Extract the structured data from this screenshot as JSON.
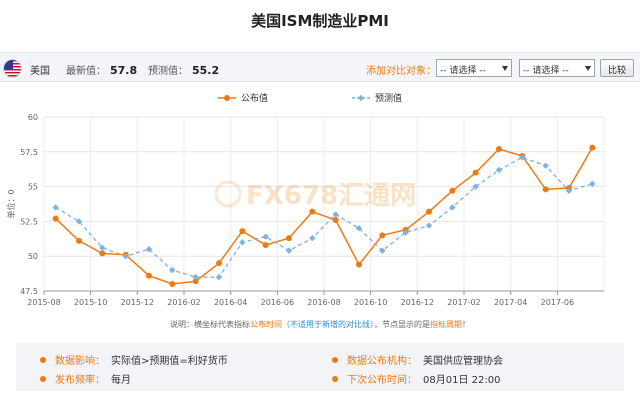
{
  "page": {
    "title": "美国ISM制造业PMI"
  },
  "toolbar": {
    "country": "美国",
    "latest_label": "最新值：",
    "latest_value": "57.8",
    "forecast_label": "预测值：",
    "forecast_value": "55.2",
    "compare_label": "添加对比对象：",
    "select1": "-- 请选择 --",
    "select2": "-- 请选择 --",
    "compare_button": "比较"
  },
  "note": {
    "prefix": "说明：横坐标代表指标",
    "highlight1": "公布时间",
    "paren": "（不适用于新增的对比线）",
    "middle": "，节点显示的是",
    "highlight2": "指标周期",
    "suffix": "！"
  },
  "info": {
    "impact_key": "数据影响：",
    "impact_val": "实际值>预期值=利好货币",
    "agency_key": "数据公布机构：",
    "agency_val": "美国供应管理协会",
    "freq_key": "发布频率：",
    "freq_val": "每月",
    "next_key": "下次公布时间：",
    "next_val": "08月01日 22:00"
  },
  "colors": {
    "actual": "#f07a12",
    "forecast": "#7fb2e0",
    "accent": "#f07a12",
    "watermark": "#f3a24a"
  },
  "chart_data": {
    "type": "line",
    "ylabel": "单位：0",
    "ylim": [
      47.5,
      60
    ],
    "yticks": [
      "47.5",
      "50",
      "52.5",
      "55",
      "57.5",
      "60"
    ],
    "xticks": [
      "2015-08",
      "2015-10",
      "2015-12",
      "2016-02",
      "2016-04",
      "2016-06",
      "2016-08",
      "2016-10",
      "2016-12",
      "2017-02",
      "2017-04",
      "2017-06"
    ],
    "grid": true,
    "legend_position": "top-center",
    "watermark": "FX678汇通网",
    "series": [
      {
        "name": "公布值",
        "x": [
          0.5,
          1.5,
          2.5,
          3.5,
          4.5,
          5.5,
          6.5,
          7.5,
          8.5,
          9.5,
          10.5,
          11.5,
          12.5,
          13.5,
          14.5,
          15.5,
          16.5,
          17.5,
          18.5,
          19.5,
          20.5,
          21.5,
          22.5,
          23.5
        ],
        "values": [
          52.7,
          51.1,
          50.2,
          50.1,
          48.6,
          48.0,
          48.2,
          49.5,
          51.8,
          50.8,
          51.3,
          53.2,
          52.6,
          49.4,
          51.5,
          51.9,
          53.2,
          54.7,
          56.0,
          57.7,
          57.2,
          54.8,
          54.9,
          57.8
        ]
      },
      {
        "name": "预测值",
        "x": [
          0.5,
          1.5,
          2.5,
          3.5,
          4.5,
          5.5,
          6.5,
          7.5,
          8.5,
          9.5,
          10.5,
          11.5,
          12.5,
          13.5,
          14.5,
          15.5,
          16.5,
          17.5,
          18.5,
          19.5,
          20.5,
          21.5,
          22.5,
          23.5
        ],
        "values": [
          53.5,
          52.5,
          50.6,
          50.0,
          50.5,
          49.0,
          48.5,
          48.5,
          51.0,
          51.4,
          50.4,
          51.3,
          53.0,
          52.0,
          50.4,
          51.7,
          52.2,
          53.5,
          55.0,
          56.2,
          57.1,
          56.5,
          54.7,
          55.2
        ]
      }
    ]
  }
}
